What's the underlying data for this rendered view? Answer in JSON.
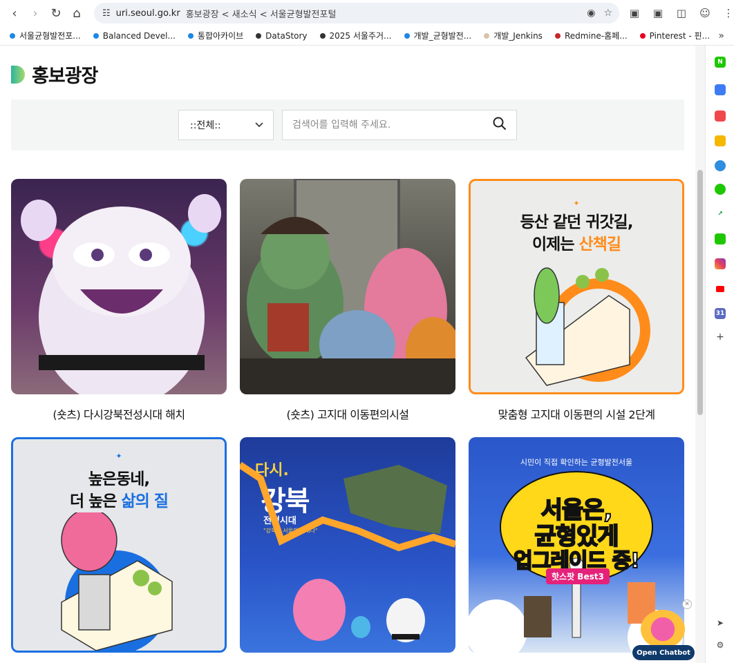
{
  "browser": {
    "url_host": "uri.seoul.go.kr",
    "url_path": "홍보광장 < 새소식 < 서울균형발전포털",
    "bookmarks": [
      {
        "label": "서울균형발전포...",
        "color": "#1e88e5"
      },
      {
        "label": "Balanced Devel...",
        "color": "#1e88e5"
      },
      {
        "label": "통합아카이브",
        "color": "#1e88e5"
      },
      {
        "label": "DataStory",
        "color": "#333333"
      },
      {
        "label": "2025 서울주거...",
        "color": "#333333"
      },
      {
        "label": "개발_균형발전...",
        "color": "#1e88e5"
      },
      {
        "label": "개발_Jenkins",
        "color": "#d9c2a8"
      },
      {
        "label": "Redmine-홈페...",
        "color": "#c62828"
      },
      {
        "label": "Pinterest - 핀...",
        "color": "#e60023"
      }
    ]
  },
  "page": {
    "title": "홍보광장",
    "search": {
      "category_selected": "::전체::",
      "placeholder": "검색어를 입력해 주세요."
    }
  },
  "cards": [
    {
      "caption": "(숏츠) 다시강북전성시대 해치",
      "art": ""
    },
    {
      "caption": "(숏츠) 고지대 이동편의시설",
      "art": ""
    },
    {
      "caption": "맞춤형 고지대 이동편의 시설 2단계",
      "art_line1": "등산 같던 귀갓길,",
      "art_line2": "이제는 ",
      "art_accent": "산책길"
    },
    {
      "caption": "",
      "art_line1": "높은동네,",
      "art_line2": "더 높은 ",
      "art_accent": "삶의 질"
    },
    {
      "caption": "",
      "art_line1": "다시.",
      "art_line2": "강북",
      "art_sub": "전성시대",
      "art_tag": "\"강북이 서울의 미래다\""
    },
    {
      "caption": "",
      "art_top": "시민이 직접 확인하는 균형발전서울",
      "art_line1": "서울은,",
      "art_line2": "균형있게",
      "art_line3": "업그레이드 중!",
      "art_badge": "핫스팟 Best3"
    }
  ],
  "chatbot": {
    "label": "Open Chatbot"
  }
}
